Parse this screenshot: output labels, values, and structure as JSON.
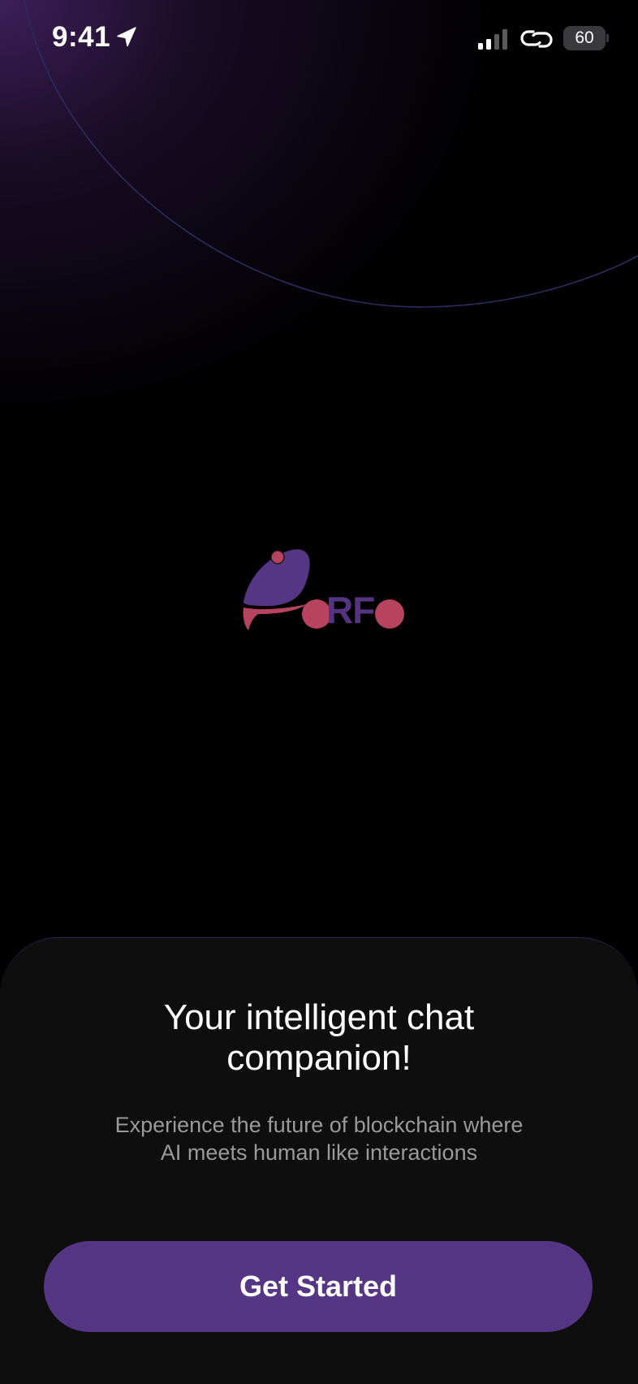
{
  "status_bar": {
    "time": "9:41",
    "battery": "60"
  },
  "logo": {
    "text": "RF"
  },
  "card": {
    "headline_line1": "Your intelligent chat",
    "headline_line2": "companion!",
    "subtext_line1": "Experience the future of blockchain where",
    "subtext_line2": "AI meets human like interactions",
    "cta_label": "Get Started"
  },
  "colors": {
    "brand_purple": "#543685",
    "brand_pink": "#b8435f",
    "card_background": "#0e0e0e",
    "page_background": "#000000"
  },
  "icons": {
    "location": "location-arrow-icon",
    "signal": "cellular-signal-icon",
    "link": "link-icon",
    "battery": "battery-icon"
  }
}
